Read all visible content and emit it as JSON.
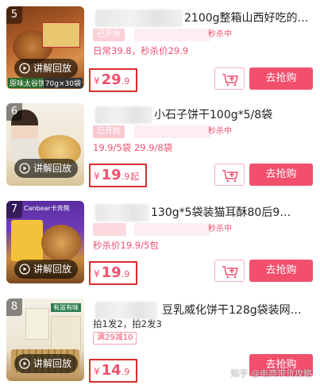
{
  "colors": {
    "accent": "#f24f6d",
    "price_box_border": "#d82d2d",
    "badge_bg": "#fbd0d7"
  },
  "icons": {
    "replay": "play-circle-icon",
    "cart": "cart-plus-icon"
  },
  "products": [
    {
      "rank": "5",
      "title": "2100g整箱山西好吃的…",
      "status_badge": "已开抢",
      "seckill_status": "秒杀中",
      "promo_line1": "日常39.8，秒杀价29.9",
      "price_symbol": "¥",
      "price_int": "29",
      "price_dec": ".9",
      "price_suffix": "",
      "replay_label": "讲解回放",
      "thumb_caption_left": "原味太谷饼",
      "thumb_caption_right": "70g×30袋",
      "buy_label": "去抢购"
    },
    {
      "rank": "6",
      "title": "小石子饼干100g*5/8袋",
      "status_badge": "已开抢",
      "seckill_status": "秒杀中",
      "promo_line1": "19.9/5袋 29.9/8袋",
      "price_symbol": "¥",
      "price_int": "19",
      "price_dec": ".9",
      "price_suffix": "起",
      "replay_label": "讲解回放",
      "buy_label": "去抢购"
    },
    {
      "rank": "7",
      "title": "130g*5袋装猫耳酥80后9…",
      "status_badge": "",
      "seckill_status": "秒杀中",
      "promo_line1": "秒杀价19.9/5包",
      "price_symbol": "¥",
      "price_int": "19",
      "price_dec": ".9",
      "price_suffix": "",
      "replay_label": "讲解回放",
      "thumb_brand": "Canbear卡奔熊",
      "buy_label": "去抢购"
    },
    {
      "rank": "8",
      "title": "豆乳威化饼干128g袋装网…",
      "promo_line1": "拍1发2，拍2发3",
      "tag": "满29减10",
      "price_symbol": "¥",
      "price_int": "14",
      "price_dec": ".9",
      "price_suffix": "",
      "replay_label": "讲解回放",
      "thumb_brand": "有滋有味",
      "buy_label": "去抢购"
    }
  ],
  "watermark": "知乎 @电商带货攻略"
}
